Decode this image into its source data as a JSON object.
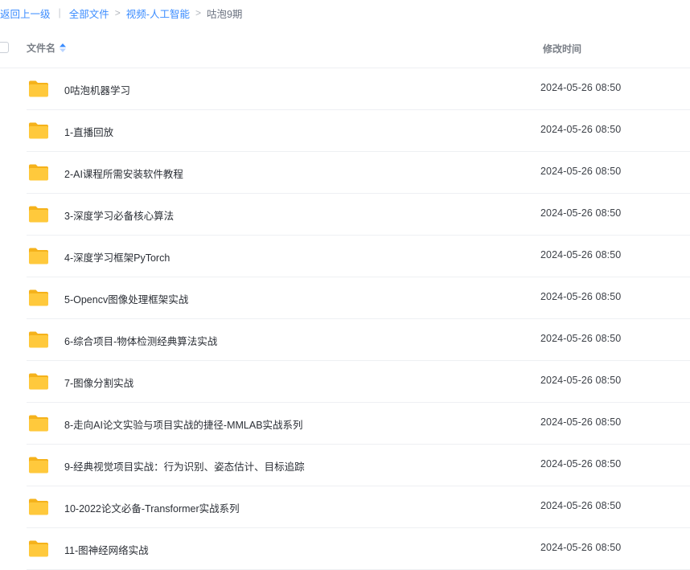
{
  "breadcrumb": {
    "back": "返回上一级",
    "all_files": "全部文件",
    "folder": "视频-人工智能",
    "current": "咕泡9期"
  },
  "header": {
    "name_col": "文件名",
    "time_col": "修改时间",
    "sort_icon": "sort-asc-icon"
  },
  "colors": {
    "link": "#3b8cff",
    "folder_yellow": "#ffc93c",
    "folder_back": "#f5b21b"
  },
  "files": [
    {
      "name": "0咕泡机器学习",
      "time": "2024-05-26 08:50",
      "icon": "folder-icon"
    },
    {
      "name": "1-直播回放",
      "time": "2024-05-26 08:50",
      "icon": "folder-icon"
    },
    {
      "name": "2-AI课程所需安装软件教程",
      "time": "2024-05-26 08:50",
      "icon": "folder-icon"
    },
    {
      "name": "3-深度学习必备核心算法",
      "time": "2024-05-26 08:50",
      "icon": "folder-icon"
    },
    {
      "name": "4-深度学习框架PyTorch",
      "time": "2024-05-26 08:50",
      "icon": "folder-icon"
    },
    {
      "name": "5-Opencv图像处理框架实战",
      "time": "2024-05-26 08:50",
      "icon": "folder-icon"
    },
    {
      "name": "6-综合项目-物体检测经典算法实战",
      "time": "2024-05-26 08:50",
      "icon": "folder-icon"
    },
    {
      "name": "7-图像分割实战",
      "time": "2024-05-26 08:50",
      "icon": "folder-icon"
    },
    {
      "name": "8-走向AI论文实验与项目实战的捷径-MMLAB实战系列",
      "time": "2024-05-26 08:50",
      "icon": "folder-icon"
    },
    {
      "name": "9-经典视觉项目实战：行为识别、姿态估计、目标追踪",
      "time": "2024-05-26 08:50",
      "icon": "folder-icon"
    },
    {
      "name": "10-2022论文必备-Transformer实战系列",
      "time": "2024-05-26 08:50",
      "icon": "folder-icon"
    },
    {
      "name": "11-图神经网络实战",
      "time": "2024-05-26 08:50",
      "icon": "folder-icon"
    }
  ]
}
